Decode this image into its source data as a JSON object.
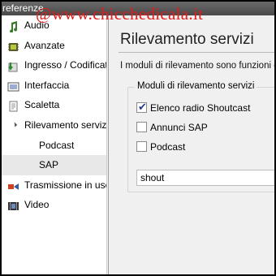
{
  "window": {
    "title": "referenze"
  },
  "watermark": {
    "text": "@www.chicchedicala.it",
    "color": "#e31b1b"
  },
  "sidebar": {
    "items": [
      {
        "label": "Audio",
        "icon": "audio-icon"
      },
      {
        "label": "Avanzate",
        "icon": "chip-icon"
      },
      {
        "label": "Ingresso / Codificatori",
        "icon": "input-codec-icon"
      },
      {
        "label": "Interfaccia",
        "icon": "interface-icon"
      },
      {
        "label": "Scaletta",
        "icon": "playlist-icon"
      },
      {
        "label": "Rilevamento servizi",
        "icon": "expand-arrow-icon",
        "expanded": true
      },
      {
        "label": "Podcast",
        "sub": true
      },
      {
        "label": "SAP",
        "sub": true,
        "selected": true
      },
      {
        "label": "Trasmissione in uscita",
        "icon": "stream-output-icon"
      },
      {
        "label": "Video",
        "icon": "video-icon"
      }
    ]
  },
  "panel": {
    "title": "Rilevamento servizi",
    "description": "I moduli di rilevamento sono funzioni che",
    "group_title": "Moduli di rilevamento servizi",
    "options": [
      {
        "label": "Elenco radio Shoutcast",
        "checked": true
      },
      {
        "label": "Annunci SAP",
        "checked": false
      },
      {
        "label": "Podcast",
        "checked": false
      }
    ],
    "entry_value": "shout"
  }
}
